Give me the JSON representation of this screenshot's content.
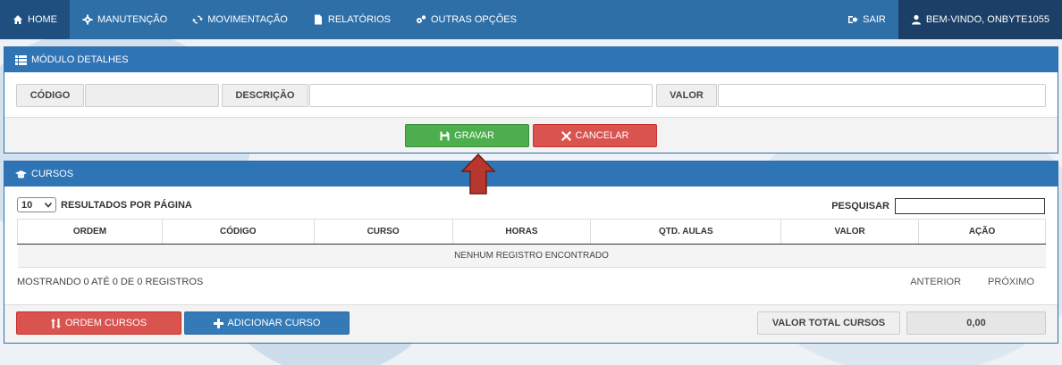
{
  "nav": {
    "home": "HOME",
    "manutencao": "MANUTENÇÃO",
    "movimentacao": "MOVIMENTAÇÃO",
    "relatorios": "RELATÓRIOS",
    "outras_opcoes": "OUTRAS OPÇÕES",
    "sair": "SAIR",
    "user": "BEM-VINDO, ONBYTE1055"
  },
  "modulo": {
    "title": "MÓDULO DETALHES",
    "codigo_label": "CÓDIGO",
    "codigo_value": "",
    "descricao_label": "DESCRIÇÃO",
    "descricao_value": "",
    "valor_label": "VALOR",
    "valor_value": "",
    "gravar": "GRAVAR",
    "cancelar": "CANCELAR"
  },
  "cursos": {
    "title": "CURSOS",
    "page_length": "10",
    "results_label": "RESULTADOS POR PÁGINA",
    "search_label": "PESQUISAR",
    "search_value": "",
    "columns": [
      "ORDEM",
      "CÓDIGO",
      "CURSO",
      "HORAS",
      "QTD. AULAS",
      "VALOR",
      "AÇÃO"
    ],
    "empty": "NENHUM REGISTRO ENCONTRADO",
    "info": "MOSTRANDO 0 ATÉ 0 DE 0 REGISTROS",
    "anterior": "ANTERIOR",
    "proximo": "PRÓXIMO",
    "ordem_cursos": "ORDEM CURSOS",
    "adicionar_curso": "ADICIONAR CURSO",
    "valor_total_label": "VALOR TOTAL CURSOS",
    "valor_total": "0,00"
  },
  "colors": {
    "navbar": "#2f6fa8",
    "panel_heading": "#2f74b5",
    "success": "#4cae4c",
    "danger": "#d9534f",
    "primary": "#337ab7",
    "arrow": "#b7372f"
  }
}
